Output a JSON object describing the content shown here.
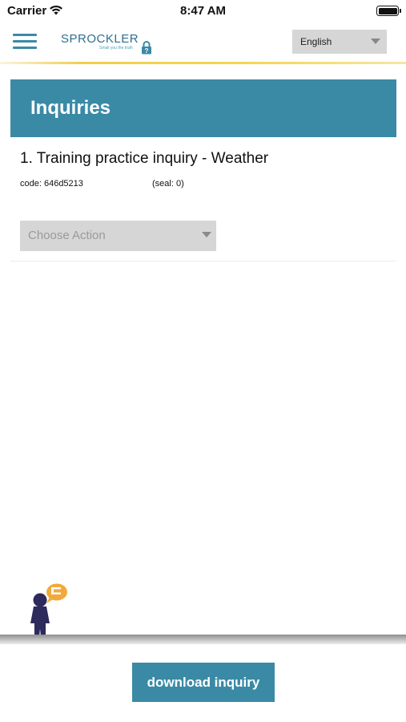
{
  "status_bar": {
    "carrier": "Carrier",
    "time": "8:47 AM"
  },
  "header": {
    "logo_text": "SPROCKLER",
    "logo_tagline": "Small you the truth",
    "language": "English",
    "accent_color": "#3a8aa6",
    "divider_color": "#f0cf4a"
  },
  "page": {
    "title": "Inquiries"
  },
  "inquiry": {
    "title": "1. Training practice inquiry - Weather",
    "code": "code: 646d5213",
    "seal": "(seal: 0)",
    "action_placeholder": "Choose Action"
  },
  "footer": {
    "download_label": "download inquiry"
  }
}
